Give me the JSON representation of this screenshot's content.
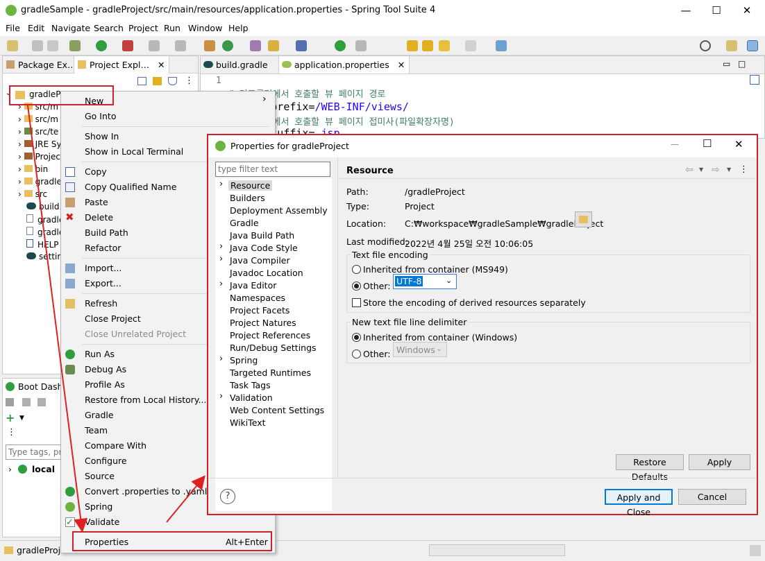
{
  "window": {
    "title": "gradleSample - gradleProject/src/main/resources/application.properties - Spring Tool Suite 4",
    "minimize": "—",
    "maximize": "☐",
    "close": "✕"
  },
  "menu": [
    "File",
    "Edit",
    "Navigate",
    "Search",
    "Project",
    "Run",
    "Window",
    "Help"
  ],
  "left_tabs": {
    "package": "Package Ex…",
    "project": "Project Expl…"
  },
  "tree": [
    "gradlePro…",
    "src/m",
    "src/m",
    "src/te",
    "JRE Sy",
    "Projec",
    "bin",
    "gradle",
    "src",
    "build.",
    "gradle",
    "gradle",
    "HELP",
    "settin"
  ],
  "editor": {
    "tabs": [
      "build.gradle",
      "application.properties"
    ],
    "line_no": "1",
    "lines": [
      "# 컨트롤러에서 호출할 뷰 페이지 경로",
      "mvc.view.prefix=/WEB-INF/views/",
      "# 컨트롤러에서 호출할 뷰 페이지 접미사(파일확장자명)",
      "spring.mvc.view.suffix=.jsp"
    ],
    "prefix_key": "mvc.view.prefix=",
    "prefix_val": "/WEB-INF/views/",
    "suffix_key": "mvc.view.suffix=",
    "suffix_val": ".jsp"
  },
  "boot": {
    "title": "Boot Dashb",
    "filter_placeholder": "Type tags, pro",
    "local": "local"
  },
  "status": {
    "left": "gradleProject"
  },
  "context_menu": {
    "items": [
      {
        "label": "New",
        "arrow": "›"
      },
      {
        "label": "Go Into"
      },
      {
        "label": "Show In"
      },
      {
        "label": "Show in Local Terminal"
      },
      {
        "label": "Copy"
      },
      {
        "label": "Copy Qualified Name"
      },
      {
        "label": "Paste"
      },
      {
        "label": "Delete"
      },
      {
        "label": "Build Path"
      },
      {
        "label": "Refactor"
      },
      {
        "label": "Import..."
      },
      {
        "label": "Export..."
      },
      {
        "label": "Refresh"
      },
      {
        "label": "Close Project"
      },
      {
        "label": "Close Unrelated Project"
      },
      {
        "label": "Run As"
      },
      {
        "label": "Debug As"
      },
      {
        "label": "Profile As"
      },
      {
        "label": "Restore from Local History..."
      },
      {
        "label": "Gradle"
      },
      {
        "label": "Team"
      },
      {
        "label": "Compare With"
      },
      {
        "label": "Configure"
      },
      {
        "label": "Source"
      },
      {
        "label": "Convert .properties to .yaml"
      },
      {
        "label": "Spring"
      },
      {
        "label": "Validate"
      },
      {
        "label": "Properties",
        "shortcut": "Alt+Enter"
      }
    ]
  },
  "dialog": {
    "title": "Properties for gradleProject",
    "filter_placeholder": "type filter text",
    "nav": [
      {
        "label": "Resource",
        "expand": true
      },
      {
        "label": "Builders"
      },
      {
        "label": "Deployment Assembly"
      },
      {
        "label": "Gradle"
      },
      {
        "label": "Java Build Path"
      },
      {
        "label": "Java Code Style",
        "expand": true
      },
      {
        "label": "Java Compiler",
        "expand": true
      },
      {
        "label": "Javadoc Location"
      },
      {
        "label": "Java Editor",
        "expand": true
      },
      {
        "label": "Namespaces"
      },
      {
        "label": "Project Facets"
      },
      {
        "label": "Project Natures"
      },
      {
        "label": "Project References"
      },
      {
        "label": "Run/Debug Settings"
      },
      {
        "label": "Spring",
        "expand": true
      },
      {
        "label": "Targeted Runtimes"
      },
      {
        "label": "Task Tags"
      },
      {
        "label": "Validation",
        "expand": true
      },
      {
        "label": "Web Content Settings"
      },
      {
        "label": "WikiText"
      }
    ],
    "page_title": "Resource",
    "path_label": "Path:",
    "path_value": "/gradleProject",
    "type_label": "Type:",
    "type_value": "Project",
    "location_label": "Location:",
    "location_value": "C:₩workspace₩gradleSample₩gradleProject",
    "modified_label": "Last modified:",
    "modified_value": "2022년 4월 25일 오전 10:06:05",
    "encoding_group": "Text file encoding",
    "inherited_label": "Inherited from container (MS949)",
    "other_label": "Other:",
    "encoding_value": "UTF-8",
    "store_label": "Store the encoding of derived resources separately",
    "delimiter_group": "New text file line delimiter",
    "inherited_delim": "Inherited from container (Windows)",
    "other_delim": "Other:",
    "delim_value": "Windows",
    "restore_btn": "Restore Defaults",
    "apply_btn": "Apply",
    "apply_close_btn": "Apply and Close",
    "cancel_btn": "Cancel",
    "help": "?"
  }
}
